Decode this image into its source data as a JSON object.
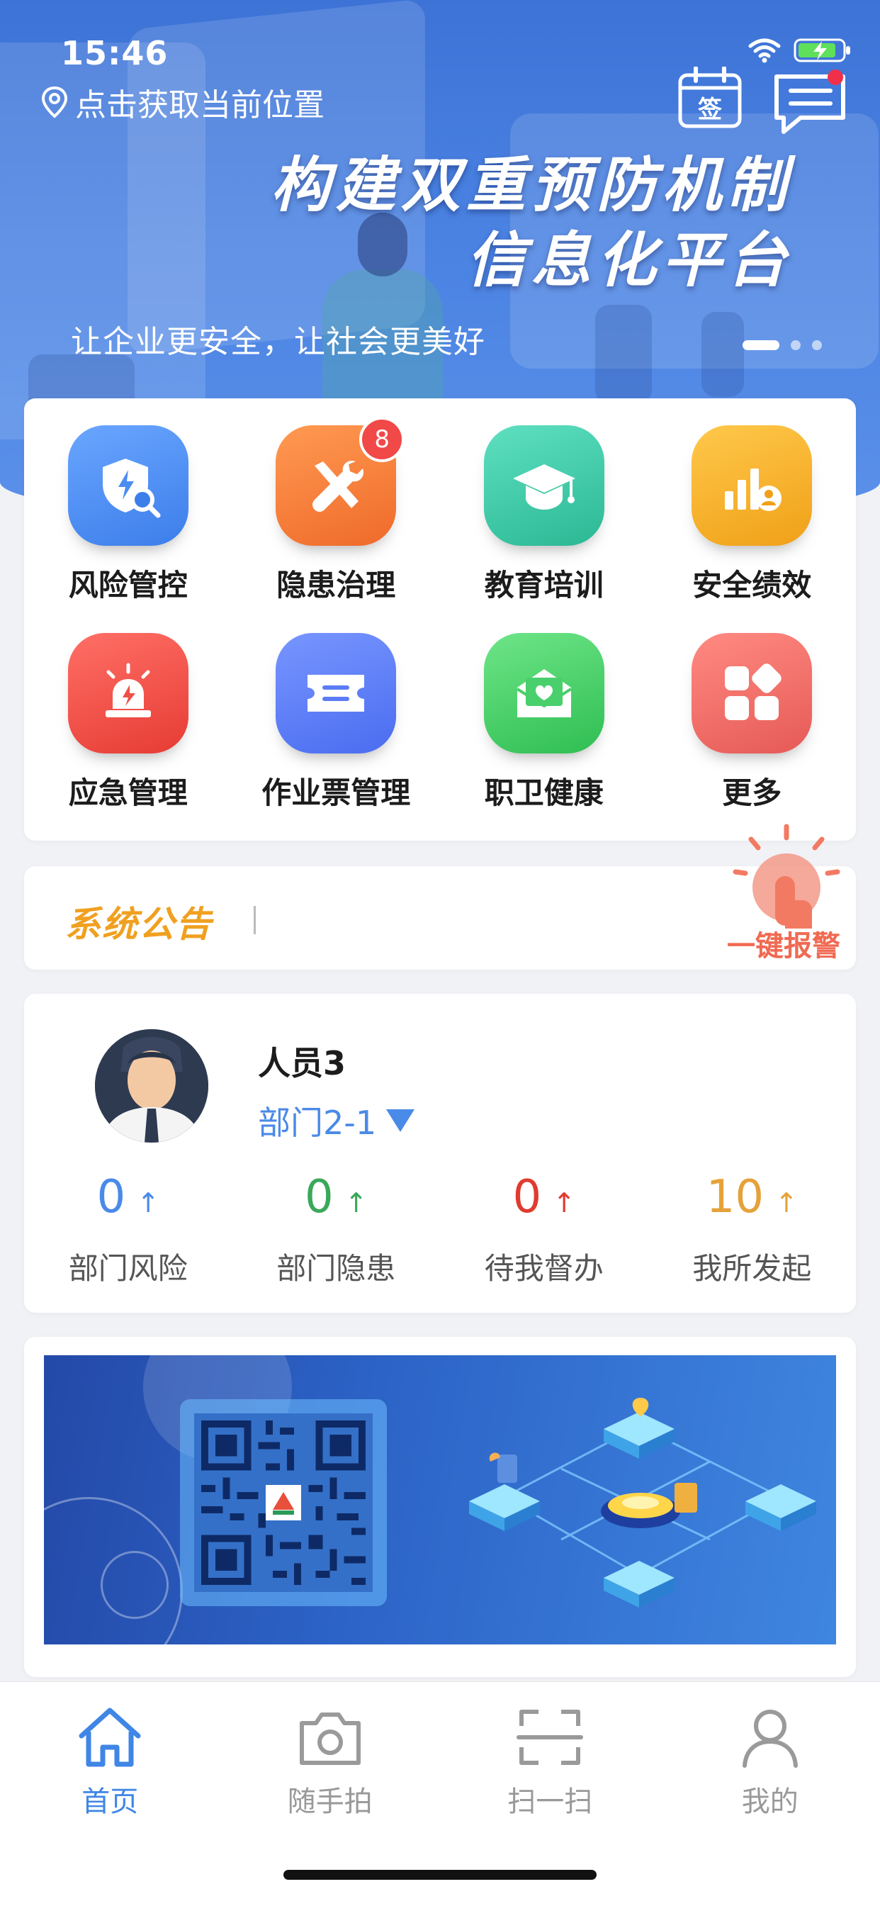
{
  "status_bar": {
    "time": "15:46"
  },
  "banner": {
    "location": "点击获取当前位置",
    "slogan_line1": "构建双重预防机制",
    "slogan_line2": "信息化平台",
    "tagline": "让企业更安全，让社会更美好",
    "sign_icon_text": "签"
  },
  "menu": {
    "items": [
      {
        "label": "风险管控",
        "icon": "shield-search-icon",
        "color": "#4b8ef0"
      },
      {
        "label": "隐患治理",
        "icon": "tools-icon",
        "color": "#f47e3a",
        "badge": "8"
      },
      {
        "label": "教育培训",
        "icon": "graduation-cap-icon",
        "color": "#3cc7a3"
      },
      {
        "label": "安全绩效",
        "icon": "chart-badge-icon",
        "color": "#f5b32a"
      },
      {
        "label": "应急管理",
        "icon": "alarm-light-icon",
        "color": "#ef5047"
      },
      {
        "label": "作业票管理",
        "icon": "ticket-icon",
        "color": "#5b7cf5"
      },
      {
        "label": "职卫健康",
        "icon": "heart-mail-icon",
        "color": "#49cf6c"
      },
      {
        "label": "更多",
        "icon": "apps-icon",
        "color": "#f0706c"
      }
    ]
  },
  "notice": {
    "title": "系统公告",
    "arrow": "›"
  },
  "alarm": {
    "label": "一键报警"
  },
  "profile": {
    "name": "人员3",
    "department": "部门2-1",
    "stats": [
      {
        "value": "0",
        "arrow": "↑",
        "label": "部门风险",
        "color": "#4a8ae8"
      },
      {
        "value": "0",
        "arrow": "↑",
        "label": "部门隐患",
        "color": "#3aa85a"
      },
      {
        "value": "0",
        "arrow": "↑",
        "label": "待我督办",
        "color": "#e03b2f"
      },
      {
        "value": "10",
        "arrow": "↑",
        "label": "我所发起",
        "color": "#e5a23a"
      }
    ]
  },
  "tabbar": {
    "items": [
      {
        "label": "首页",
        "icon": "home-icon",
        "active": true
      },
      {
        "label": "随手拍",
        "icon": "camera-icon",
        "active": false
      },
      {
        "label": "扫一扫",
        "icon": "scan-icon",
        "active": false
      },
      {
        "label": "我的",
        "icon": "user-icon",
        "active": false
      }
    ]
  },
  "colors": {
    "accent": "#3f86e6",
    "banner": "#4a82e2",
    "notice_title": "#f0a020"
  }
}
